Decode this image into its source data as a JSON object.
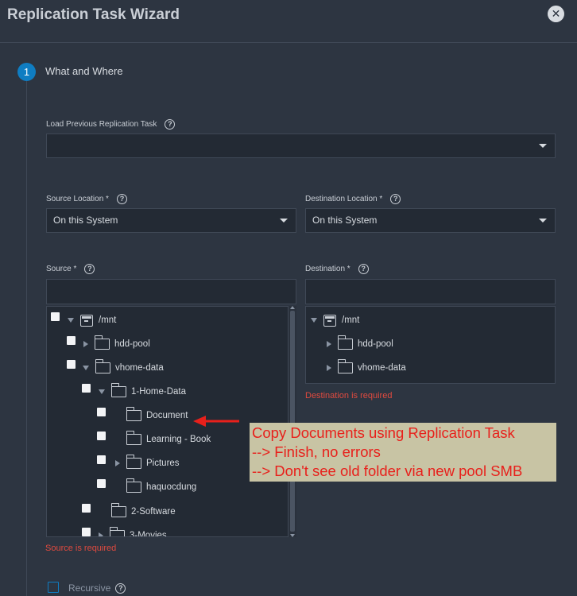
{
  "dialog": {
    "title": "Replication Task Wizard",
    "close_icon": "close-icon"
  },
  "step": {
    "number": "1",
    "label": "What and Where"
  },
  "load_previous": {
    "label": "Load Previous Replication Task",
    "value": ""
  },
  "source_location": {
    "label": "Source Location *",
    "value": "On this System"
  },
  "destination_location": {
    "label": "Destination Location *",
    "value": "On this System"
  },
  "source": {
    "label": "Source *",
    "value": "",
    "error": "Source is required",
    "tree": [
      {
        "name": "/mnt",
        "icon": "drive-icon",
        "expanded": true
      },
      {
        "name": "hdd-pool",
        "icon": "folder-icon",
        "expanded": false
      },
      {
        "name": "vhome-data",
        "icon": "folder-icon",
        "expanded": true
      },
      {
        "name": "1-Home-Data",
        "icon": "folder-icon",
        "expanded": true
      },
      {
        "name": "Document",
        "icon": "folder-icon"
      },
      {
        "name": "Learning - Book",
        "icon": "folder-icon"
      },
      {
        "name": "Pictures",
        "icon": "folder-icon",
        "expanded": false
      },
      {
        "name": "haquocdung",
        "icon": "folder-icon"
      },
      {
        "name": "2-Software",
        "icon": "folder-icon"
      },
      {
        "name": "3-Movies",
        "icon": "folder-icon",
        "expanded": false
      }
    ]
  },
  "destination": {
    "label": "Destination *",
    "value": "",
    "error": "Destination is required",
    "tree": [
      {
        "name": "/mnt",
        "icon": "drive-icon",
        "expanded": true
      },
      {
        "name": "hdd-pool",
        "icon": "folder-icon",
        "expanded": false
      },
      {
        "name": "vhome-data",
        "icon": "folder-icon",
        "expanded": false
      }
    ]
  },
  "annotation": {
    "lines": [
      "Copy Documents using Replication Task",
      "--> Finish, no errors",
      "--> Don't see old folder via new pool SMB"
    ],
    "color": "#e8201b"
  },
  "recursive": {
    "label": "Recursive",
    "checked": false
  },
  "colors": {
    "background": "#2d3541",
    "field": "#232a34",
    "accent": "#0f7dc2",
    "error": "#e04a3f"
  }
}
